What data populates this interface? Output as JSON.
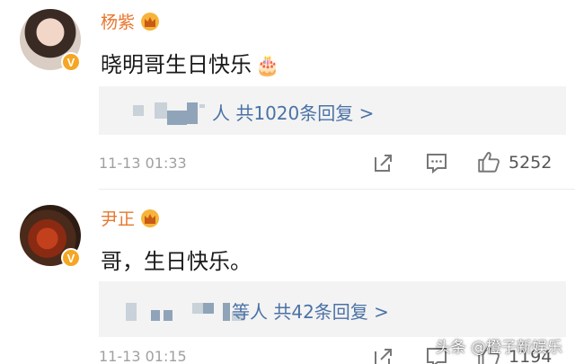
{
  "comments": [
    {
      "author": "杨紫",
      "text": "晓明哥生日快乐",
      "text_emoji": "🎂",
      "reply_summary": "人 共1020条回复 >",
      "timestamp": "11-13 01:33",
      "like_count": "5252"
    },
    {
      "author": "尹正",
      "text": "哥，生日快乐。",
      "reply_summary": "等人 共42条回复 >",
      "timestamp": "11-13 01:15",
      "like_count": "1194"
    }
  ],
  "watermark": "头条 @橙子新娱乐",
  "icons": {
    "verified": "verified-badge-icon",
    "crown": "crown-icon",
    "share": "share-icon",
    "comment": "comment-icon",
    "like": "like-icon"
  },
  "colors": {
    "author_name": "#e8772e",
    "reply_link": "#4a72a6",
    "verified_badge": "#f5a623"
  }
}
